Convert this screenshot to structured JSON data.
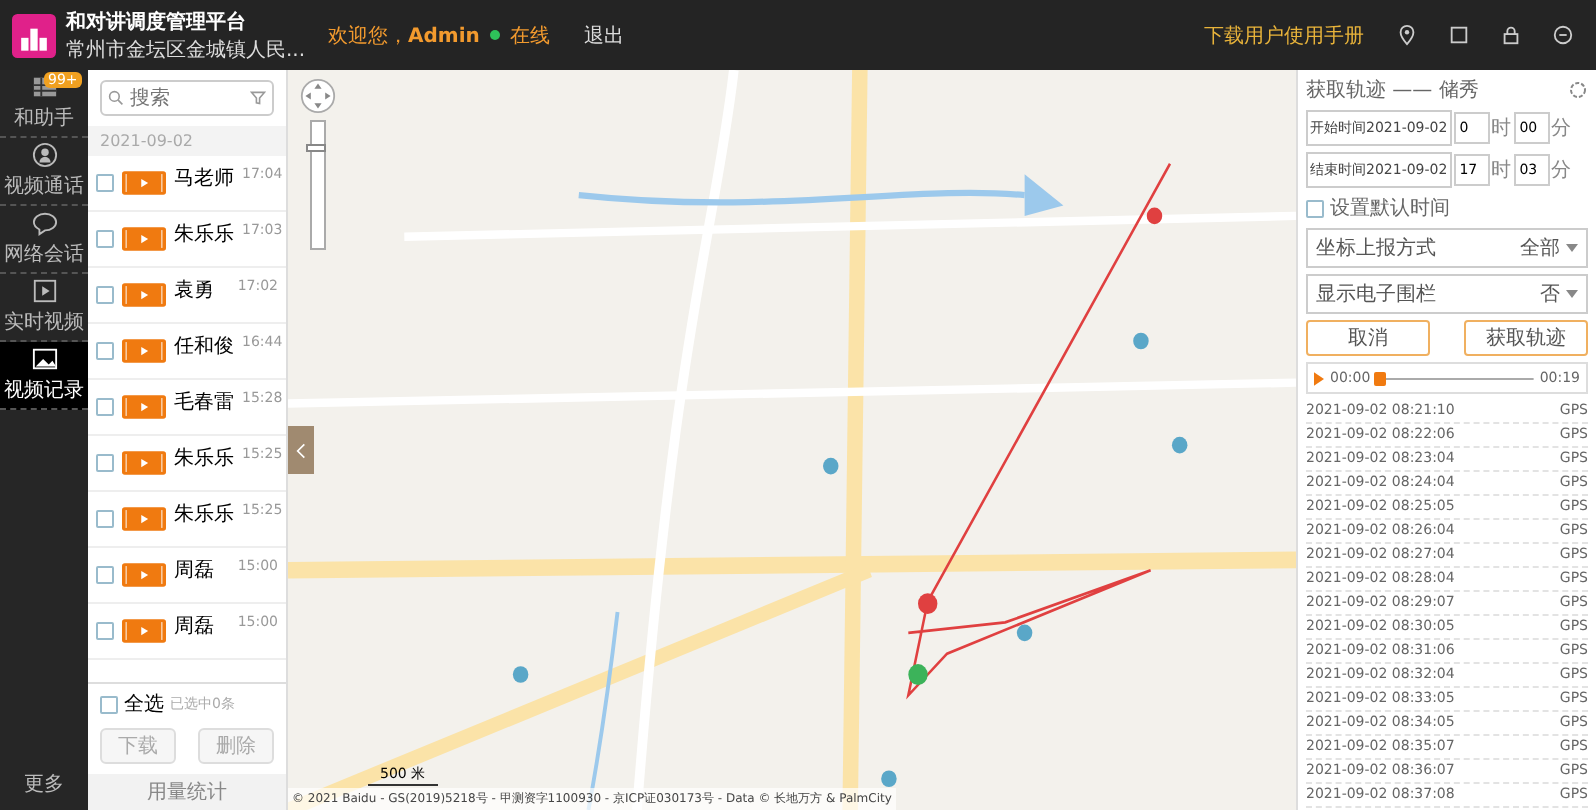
{
  "header": {
    "app_title": "和对讲调度管理平台",
    "org": "常州市金坛区金城镇人民...",
    "welcome": "欢迎您，",
    "user": "Admin",
    "status": "在线",
    "online": true,
    "logout": "退出",
    "manual_link": "下载用户使用手册"
  },
  "nav": [
    {
      "label": "和助手",
      "badge": "99+",
      "selected": false
    },
    {
      "label": "视频通话",
      "selected": false
    },
    {
      "label": "网络会话",
      "selected": false
    },
    {
      "label": "实时视频",
      "selected": false
    },
    {
      "label": "视频记录",
      "selected": true
    }
  ],
  "nav_more": "更多",
  "records": {
    "search_placeholder": "搜索",
    "date": "2021-09-02",
    "items": [
      {
        "name": "马老师",
        "time": "17:04",
        "checked": false
      },
      {
        "name": "朱乐乐",
        "time": "17:03",
        "checked": false
      },
      {
        "name": "袁勇",
        "time": "17:02",
        "checked": false
      },
      {
        "name": "任和俊",
        "time": "16:44",
        "checked": false
      },
      {
        "name": "毛春雷",
        "time": "15:28",
        "checked": false
      },
      {
        "name": "朱乐乐",
        "time": "15:25",
        "checked": false
      },
      {
        "name": "朱乐乐",
        "time": "15:25",
        "checked": false
      },
      {
        "name": "周磊",
        "time": "15:00",
        "checked": false
      },
      {
        "name": "周磊",
        "time": "15:00",
        "checked": false
      }
    ],
    "select_all": "全选",
    "select_all_checked": false,
    "selected_count": "已选中0条",
    "download": "下载",
    "delete": "删除",
    "usage": "用量统计"
  },
  "map": {
    "zoom": {
      "level": 0.8
    },
    "scale": "500 米",
    "copyright": "© 2021 Baidu - GS(2019)5218号 - 甲测资字1100930 - 京ICP证030173号 - Data © 长地万方 & PalmCity"
  },
  "track": {
    "title": "获取轨迹 —— 储秀",
    "start_label": "开始时间",
    "start_date": "2021-09-02",
    "start_hour": "0",
    "start_min": "00",
    "end_label": "结束时间",
    "end_date": "2021-09-02",
    "end_hour": "17",
    "end_min": "03",
    "start_hour_unit": "时",
    "start_min_unit": "分",
    "end_hour_unit": "时",
    "end_min_unit": "分",
    "default_time": "设置默认时间",
    "default_checked": false,
    "mode_label": "坐标上报方式",
    "mode_value": "全部",
    "fence_label": "显示电子围栏",
    "fence_value": "否",
    "cancel": "取消",
    "fetch": "获取轨迹",
    "play_start": "00:00",
    "play_end": "00:19",
    "level": 0,
    "points": [
      {
        "time": "2021-09-02 08:21:10",
        "src": "GPS"
      },
      {
        "time": "2021-09-02 08:22:06",
        "src": "GPS"
      },
      {
        "time": "2021-09-02 08:23:04",
        "src": "GPS"
      },
      {
        "time": "2021-09-02 08:24:04",
        "src": "GPS"
      },
      {
        "time": "2021-09-02 08:25:05",
        "src": "GPS"
      },
      {
        "time": "2021-09-02 08:26:04",
        "src": "GPS"
      },
      {
        "time": "2021-09-02 08:27:04",
        "src": "GPS"
      },
      {
        "time": "2021-09-02 08:28:04",
        "src": "GPS"
      },
      {
        "time": "2021-09-02 08:29:07",
        "src": "GPS"
      },
      {
        "time": "2021-09-02 08:30:05",
        "src": "GPS"
      },
      {
        "time": "2021-09-02 08:31:06",
        "src": "GPS"
      },
      {
        "time": "2021-09-02 08:32:04",
        "src": "GPS"
      },
      {
        "time": "2021-09-02 08:33:05",
        "src": "GPS"
      },
      {
        "time": "2021-09-02 08:34:05",
        "src": "GPS"
      },
      {
        "time": "2021-09-02 08:35:07",
        "src": "GPS"
      },
      {
        "time": "2021-09-02 08:36:07",
        "src": "GPS"
      },
      {
        "time": "2021-09-02 08:37:08",
        "src": "GPS"
      }
    ]
  }
}
